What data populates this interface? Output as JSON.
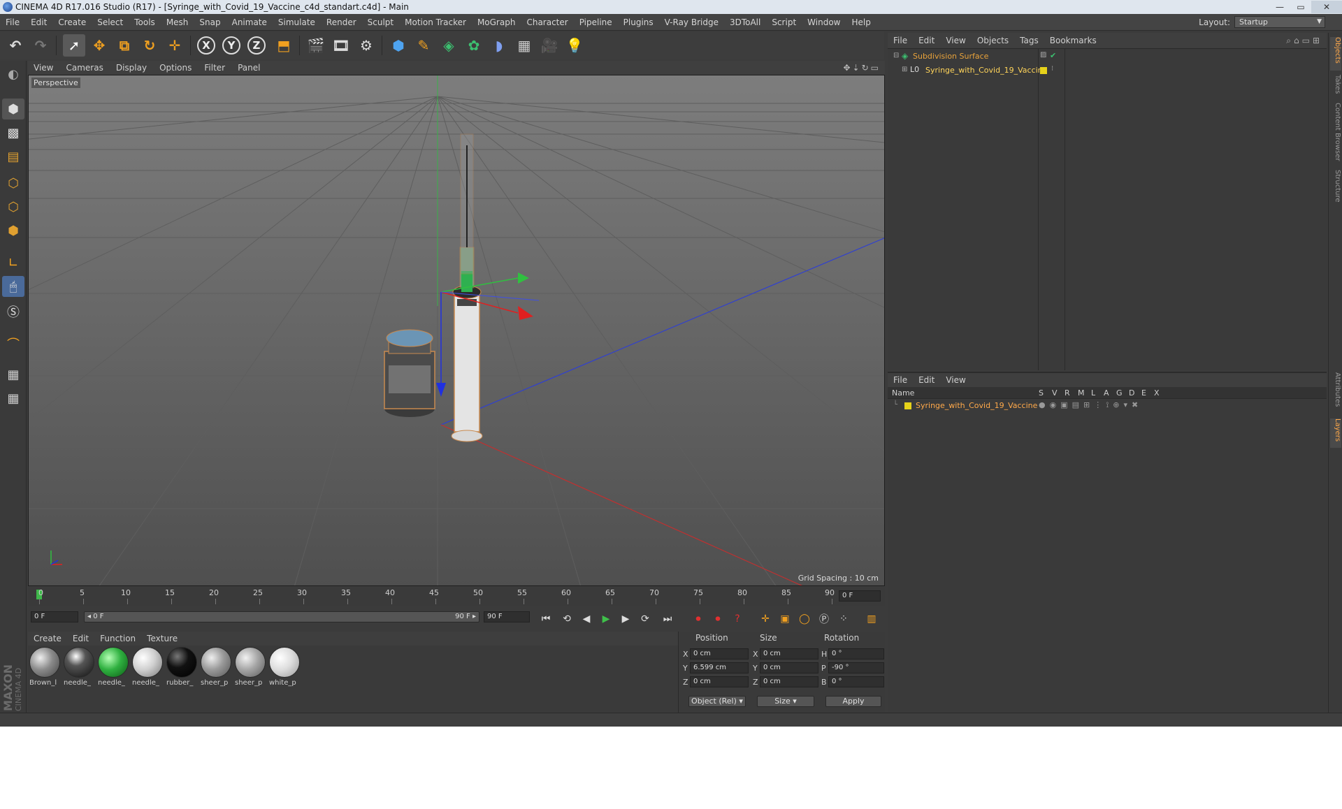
{
  "window": {
    "title": "CINEMA 4D R17.016 Studio (R17) - [Syringe_with_Covid_19_Vaccine_c4d_standart.c4d] - Main",
    "minimize": "—",
    "maximize": "▭",
    "close": "✕"
  },
  "menubar": {
    "items": [
      "File",
      "Edit",
      "Create",
      "Select",
      "Tools",
      "Mesh",
      "Snap",
      "Animate",
      "Simulate",
      "Render",
      "Sculpt",
      "Motion Tracker",
      "MoGraph",
      "Character",
      "Pipeline",
      "Plugins",
      "V-Ray Bridge",
      "3DToAll",
      "Script",
      "Window",
      "Help"
    ],
    "layout_label": "Layout:",
    "layout_value": "Startup"
  },
  "toolbar": {
    "icons": [
      "undo-icon",
      "redo-icon",
      "select-arrow-icon",
      "move-icon",
      "scale-icon",
      "rotate-icon",
      "multi-transform-icon",
      "x-axis-icon",
      "y-axis-icon",
      "z-axis-icon",
      "coordinate-system-icon",
      "render-view-icon",
      "render-picture-viewer-icon",
      "render-settings-icon",
      "cube-icon",
      "pen-spline-icon",
      "subdivision-icon",
      "array-icon",
      "deformer-icon",
      "floor-icon",
      "camera-icon",
      "light-icon"
    ],
    "axis_x": "X",
    "axis_y": "Y",
    "axis_z": "Z"
  },
  "viewport": {
    "menu": [
      "View",
      "Cameras",
      "Display",
      "Options",
      "Filter",
      "Panel"
    ],
    "label": "Perspective",
    "grid_spacing": "Grid Spacing : 10 cm"
  },
  "timeline": {
    "ticks": [
      "0",
      "5",
      "10",
      "15",
      "20",
      "25",
      "30",
      "35",
      "40",
      "45",
      "50",
      "55",
      "60",
      "65",
      "70",
      "75",
      "80",
      "85",
      "90"
    ],
    "current_frame": "0 F",
    "start_field": "0 F",
    "range_start": "◂ 0 F",
    "range_end": "90 F ▸",
    "end_field": "90 F"
  },
  "materials": {
    "menu": [
      "Create",
      "Edit",
      "Function",
      "Texture"
    ],
    "items": [
      {
        "name": "Brown_l"
      },
      {
        "name": "needle_"
      },
      {
        "name": "needle_"
      },
      {
        "name": "needle_"
      },
      {
        "name": "rubber_"
      },
      {
        "name": "sheer_p"
      },
      {
        "name": "sheer_p"
      },
      {
        "name": "white_p"
      }
    ]
  },
  "coordinates": {
    "headers": {
      "position": "Position",
      "size": "Size",
      "rotation": "Rotation"
    },
    "rows": [
      {
        "axis": "X",
        "pos": "0 cm",
        "size_axis": "X",
        "size": "0 cm",
        "rot_axis": "H",
        "rot": "0 °"
      },
      {
        "axis": "Y",
        "pos": "6.599 cm",
        "size_axis": "Y",
        "size": "0 cm",
        "rot_axis": "P",
        "rot": "-90 °"
      },
      {
        "axis": "Z",
        "pos": "0 cm",
        "size_axis": "Z",
        "size": "0 cm",
        "rot_axis": "B",
        "rot": "0 °"
      }
    ],
    "mode": "Object (Rel)",
    "size_mode": "Size",
    "apply": "Apply"
  },
  "object_manager": {
    "menu": [
      "File",
      "Edit",
      "View",
      "Objects",
      "Tags",
      "Bookmarks"
    ],
    "objects": [
      {
        "name": "Subdivision Surface",
        "color": "#e8a23a"
      },
      {
        "name": "Syringe_with_Covid_19_Vaccine",
        "color": "#ffd45a"
      }
    ]
  },
  "layer_manager": {
    "menu": [
      "File",
      "Edit",
      "View"
    ],
    "columns": [
      "Name",
      "S",
      "V",
      "R",
      "M",
      "L",
      "A",
      "G",
      "D",
      "E",
      "X"
    ],
    "layers": [
      {
        "name": "Syringe_with_Covid_19_Vaccine",
        "color": "#e6d21a"
      }
    ]
  },
  "right_tabs": [
    "Objects",
    "Takes",
    "Content Browser",
    "Structure",
    "Attributes",
    "Layers"
  ],
  "branding": {
    "maxon": "MAXON",
    "cinema": "CINEMA 4D"
  },
  "colors": {
    "accent_orange": "#ffa94a",
    "object_label": "#ffd45a",
    "x_axis": "#e02020",
    "y_axis": "#30c030",
    "z_axis": "#2030e0"
  }
}
